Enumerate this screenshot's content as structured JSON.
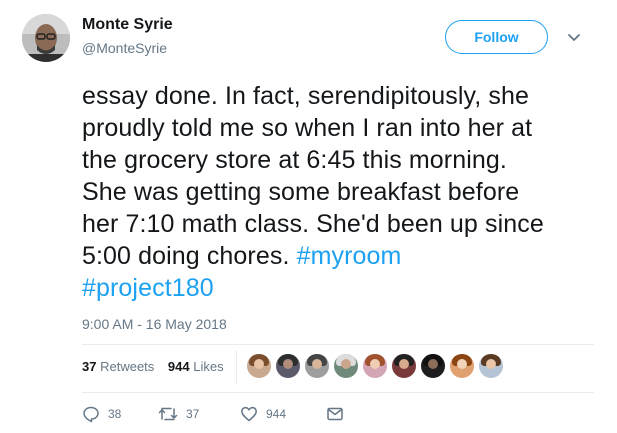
{
  "author": {
    "name": "Monte Syrie",
    "handle": "@MonteSyrie"
  },
  "follow_label": "Follow",
  "tweet": {
    "lines": [
      "essay done. In fact, serendipitously, she",
      "proudly told me so when I ran into her at",
      "the grocery store at 6:45 this morning.",
      "She was getting some breakfast before",
      "her 7:10 math class. She'd been up since"
    ],
    "line6_text": "5:00 doing chores.",
    "hashtag1": "#myroom",
    "hashtag2": "#project180"
  },
  "timestamp": "9:00 AM - 16 May 2018",
  "stats": {
    "retweets_count": "37",
    "retweets_label": "Retweets",
    "likes_count": "944",
    "likes_label": "Likes"
  },
  "actions": {
    "reply_count": "38",
    "retweet_count": "37",
    "like_count": "944"
  },
  "icons": {
    "reply": "reply-icon",
    "retweet": "retweet-icon",
    "like": "heart-icon",
    "dm": "direct-message-icon",
    "caret": "chevron-down-icon"
  },
  "colors": {
    "accent": "#1da1f2",
    "text": "#14171a",
    "secondary": "#657786",
    "divider": "#e6ecf0"
  }
}
